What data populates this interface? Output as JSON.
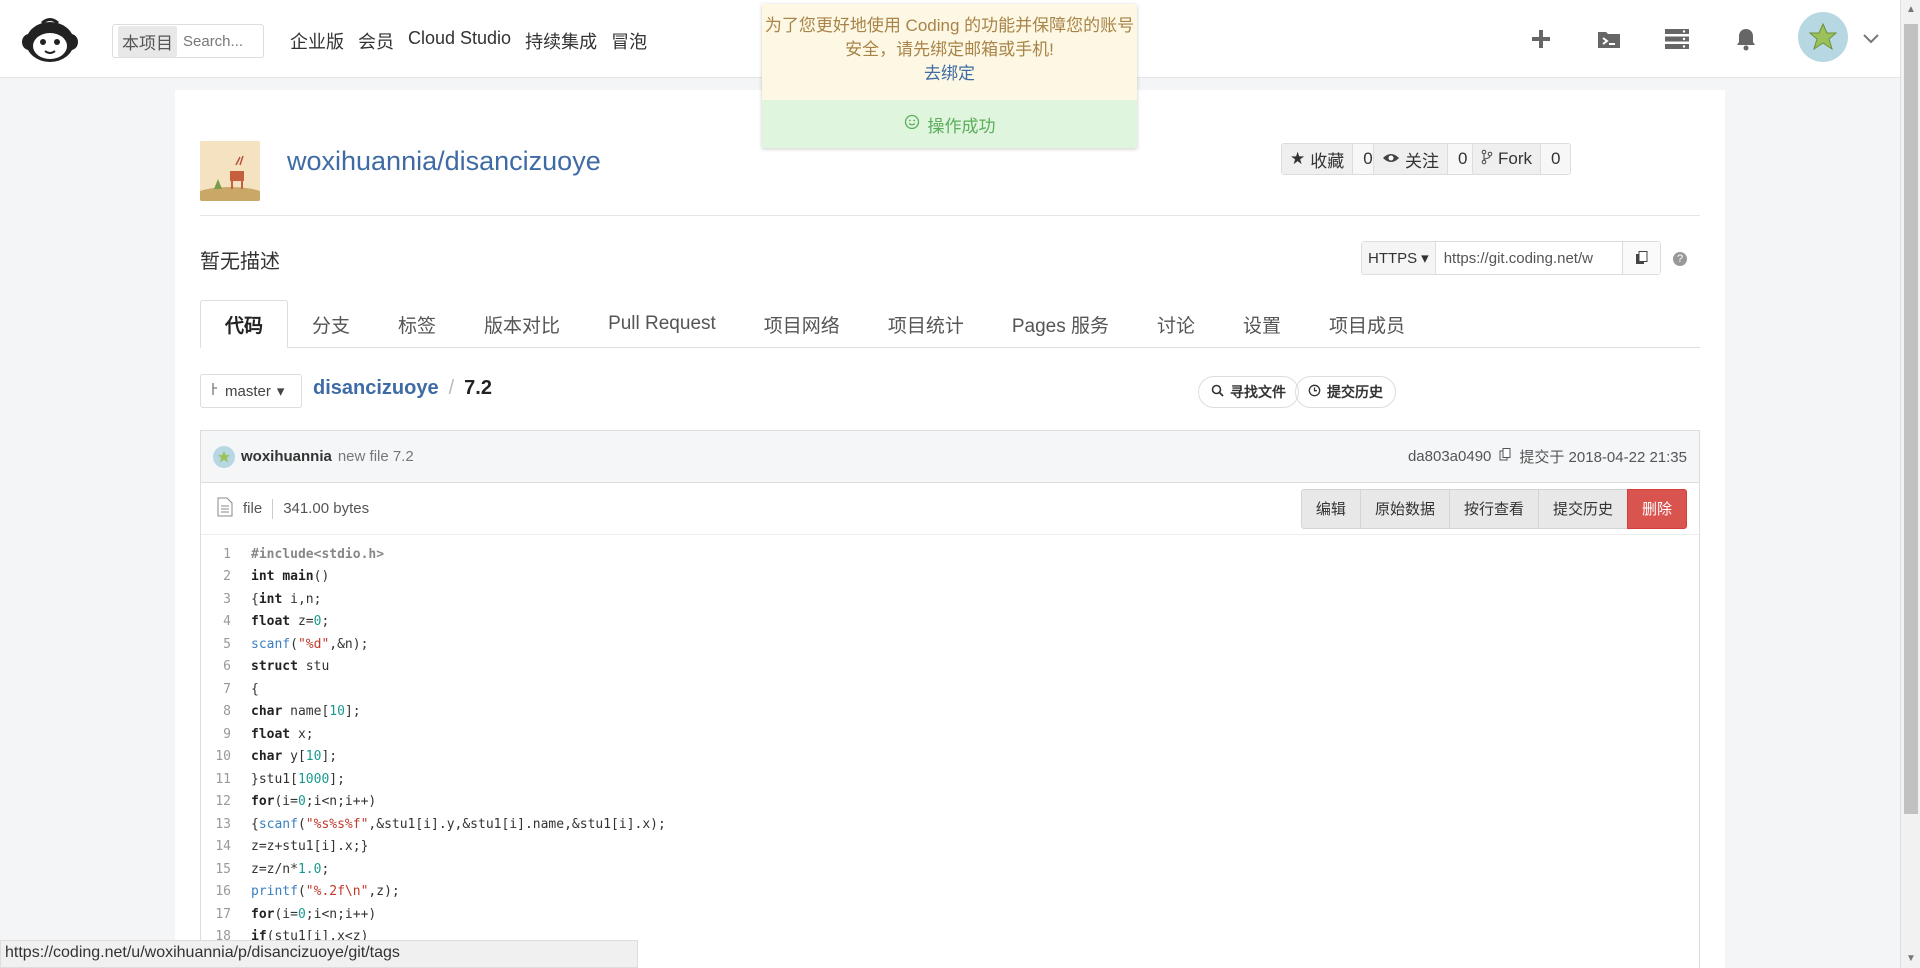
{
  "header": {
    "search_scope": "本项目",
    "search_placeholder": "Search...",
    "nav": [
      "企业版",
      "会员",
      "Cloud Studio",
      "持续集成",
      "冒泡"
    ]
  },
  "notice": {
    "warning_text": "为了您更好地使用 Coding 的功能并保障您的账号安全，请先绑定邮箱或手机!",
    "bind_link": "去绑定",
    "success_text": "操作成功"
  },
  "project": {
    "title": "woxihuannia/disancizuoye",
    "description": "暂无描述",
    "stats": [
      {
        "label": "收藏",
        "count": "0"
      },
      {
        "label": "关注",
        "count": "0"
      },
      {
        "label": "Fork",
        "count": "0"
      }
    ],
    "clone_protocol": "HTTPS",
    "clone_url": "https://git.coding.net/w"
  },
  "tabs": [
    "代码",
    "分支",
    "标签",
    "版本对比",
    "Pull Request",
    "项目网络",
    "项目统计",
    "Pages 服务",
    "讨论",
    "设置",
    "项目成员"
  ],
  "path": {
    "branch": "master",
    "repo": "disancizuoye",
    "file": "7.2",
    "find_file": "寻找文件",
    "commit_history": "提交历史"
  },
  "commit": {
    "author": "woxihuannia",
    "message": "new file 7.2",
    "hash": "da803a0490",
    "time": "提交于 2018-04-22 21:35"
  },
  "file": {
    "type": "file",
    "size": "341.00 bytes",
    "actions": [
      "编辑",
      "原始数据",
      "按行查看",
      "提交历史",
      "删除"
    ]
  },
  "code": [
    {
      "n": "1",
      "t": "#include<stdio.h>"
    },
    {
      "n": "2",
      "t": "int main()"
    },
    {
      "n": "3",
      "t": "{int i,n;"
    },
    {
      "n": "4",
      "t": "float z=0;"
    },
    {
      "n": "5",
      "t": "scanf(\"%d\",&n);"
    },
    {
      "n": "6",
      "t": "struct stu"
    },
    {
      "n": "7",
      "t": "{"
    },
    {
      "n": "8",
      "t": "char name[10];"
    },
    {
      "n": "9",
      "t": "float x;"
    },
    {
      "n": "10",
      "t": "char y[10];"
    },
    {
      "n": "11",
      "t": "}stu1[1000];"
    },
    {
      "n": "12",
      "t": "for(i=0;i<n;i++)"
    },
    {
      "n": "13",
      "t": "{scanf(\"%s%s%f\",&stu1[i].y,&stu1[i].name,&stu1[i].x);"
    },
    {
      "n": "14",
      "t": "z=z+stu1[i].x;}"
    },
    {
      "n": "15",
      "t": "z=z/n*1.0;"
    },
    {
      "n": "16",
      "t": "printf(\"%.2f\\n\",z);"
    },
    {
      "n": "17",
      "t": "for(i=0;i<n;i++)"
    },
    {
      "n": "18",
      "t": "if(stu1[i].x<z)"
    }
  ],
  "status_url": "https://coding.net/u/woxihuannia/p/disancizuoye/git/tags"
}
